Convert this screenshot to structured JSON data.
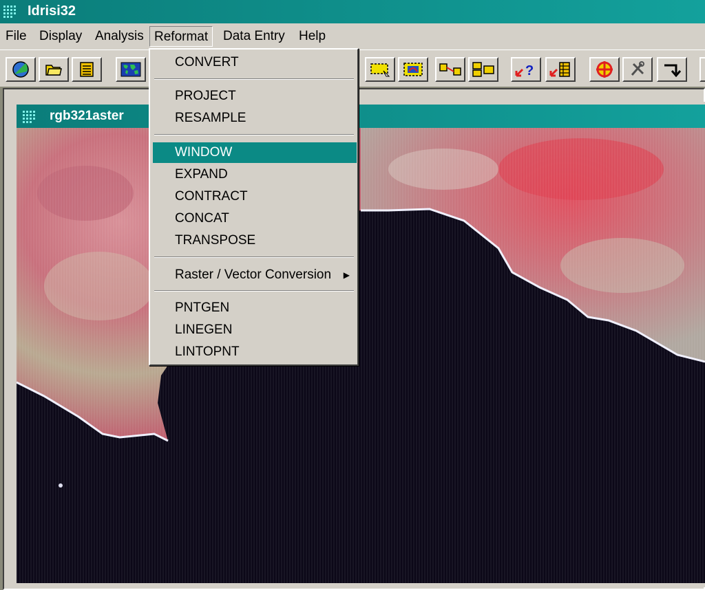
{
  "app": {
    "title": "Idrisi32"
  },
  "menubar": {
    "items": [
      {
        "label": "File"
      },
      {
        "label": "Display"
      },
      {
        "label": "Analysis"
      },
      {
        "label": "Reformat"
      },
      {
        "label": "Data Entry"
      },
      {
        "label": "Help"
      }
    ]
  },
  "reformat_menu": {
    "items": [
      {
        "label": "CONVERT"
      },
      {
        "label": "PROJECT"
      },
      {
        "label": "RESAMPLE"
      },
      {
        "label": "WINDOW",
        "highlighted": true
      },
      {
        "label": "EXPAND"
      },
      {
        "label": "CONTRACT"
      },
      {
        "label": "CONCAT"
      },
      {
        "label": "TRANSPOSE"
      },
      {
        "label": "Raster / Vector Conversion",
        "submenu": true
      },
      {
        "label": "PNTGEN"
      },
      {
        "label": "LINEGEN"
      },
      {
        "label": "LINTOPNT"
      }
    ]
  },
  "toolbar": {
    "icons": [
      "globe-icon",
      "open-folder-icon",
      "list-icon",
      "world-map-icon",
      "select-window-icon",
      "map-window-icon",
      "link-icon",
      "compare-icon",
      "query-icon",
      "table-query-icon",
      "target-icon",
      "tools-icon",
      "return-icon"
    ]
  },
  "map_window": {
    "title": "rgb321aster"
  },
  "colors": {
    "titlebar": "#0b7d7a",
    "highlight": "#0b8a85",
    "chrome": "#d4d0c8",
    "sea": "#0c0818",
    "land": "#c85070"
  }
}
